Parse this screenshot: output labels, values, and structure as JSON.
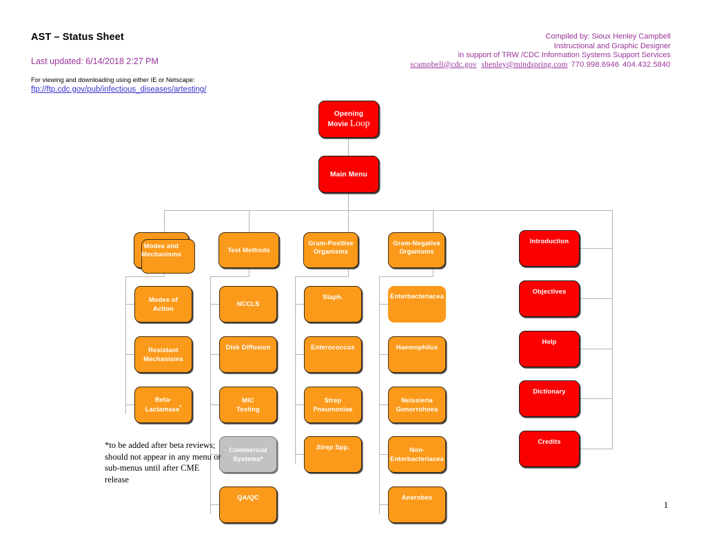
{
  "header": {
    "title": "AST – Status Sheet",
    "last_updated": "Last updated: 6/14/2018 2:27 PM",
    "viewing_note": "For viewing and downloading using either IE or Netscape:",
    "ftp_link": "ftp://ftp.cdc.gov/pub/infectious_diseases/artesting/",
    "accent_color": "#993399",
    "link_color": "#3333cc"
  },
  "credits": {
    "line1": "Compiled by:  Sioux Henley Campbell",
    "line2": "Instructional and Graphic Designer",
    "line3": "in support of TRW /CDC Information Systems Support Services",
    "email1": "scampbell@cdc.gov",
    "email2": "shenley@mindspring.com",
    "phone1": "770.998.6946",
    "phone2": "404.432.5840"
  },
  "footnote": "*to be added after beta reviews; should not appear in any menu or sub-menus until after CME release",
  "page_number": "1",
  "colors": {
    "red": "#fa0000",
    "orange": "#fb9a1a",
    "gray": "#c2c2c2",
    "connector": "#b3b3b3"
  },
  "flowchart": {
    "top": {
      "opening_line1": "Opening",
      "opening_line2a": "Movie ",
      "opening_line2b": "Loop",
      "main_menu": "Main Menu"
    },
    "columns": [
      {
        "id": "modes-and-mechanisms",
        "head": {
          "line1": "Modes and",
          "line2": "Mechanisms"
        },
        "children": [
          {
            "line1": "Modes of",
            "line2": "Action"
          },
          {
            "line1": "Resistant",
            "line2": "Mechanisms"
          },
          {
            "line1": "Beta-",
            "line2": "Lactamase",
            "sup": "*"
          }
        ]
      },
      {
        "id": "test-methods",
        "head": {
          "line1": "Test Methods",
          "line2": ""
        },
        "children": [
          {
            "line1": "NCCLS",
            "line2": ""
          },
          {
            "line1": "Disk Diffusion",
            "line2": ""
          },
          {
            "line1": "MIC",
            "line2": "Testing"
          },
          {
            "line1": "Commercial",
            "line2": "Systems*"
          },
          {
            "line1": "QA/QC",
            "line2": ""
          }
        ]
      },
      {
        "id": "gram-positive-organisms",
        "head": {
          "line1": "Gram-Positive",
          "line2": "Organisms"
        },
        "children": [
          {
            "line1": "Staph.",
            "line2": ""
          },
          {
            "line1": "Enterococcus",
            "line2": ""
          },
          {
            "line1": "Strep",
            "line2": "Pneumoniae"
          },
          {
            "line1_italic": "Strep",
            "line1_rest": " Spp.",
            "line2": ""
          }
        ]
      },
      {
        "id": "gram-negative-organisms",
        "head": {
          "line1": "Gram-Negative",
          "line2": "Organisms"
        },
        "children": [
          {
            "line1": "Enterbacteriacea",
            "line2": ""
          },
          {
            "line1": "Haemophilus",
            "line2": ""
          },
          {
            "line1": "Neissieria",
            "line2": "Gonorrohoea"
          },
          {
            "line1": "Non-",
            "line2": "Enterbacteriacea"
          },
          {
            "line1": "Anerobes",
            "line2": ""
          }
        ]
      }
    ],
    "side_menu": [
      {
        "label": "Introduction"
      },
      {
        "label": "Objectives"
      },
      {
        "label": "Help"
      },
      {
        "label": "Dictionary"
      },
      {
        "label": "Credits"
      }
    ]
  }
}
